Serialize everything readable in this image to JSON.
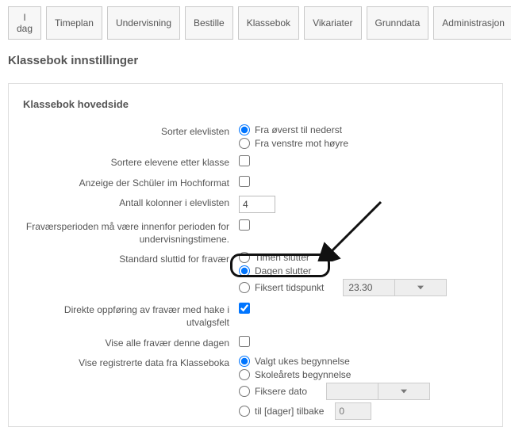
{
  "tabs": [
    "I dag",
    "Timeplan",
    "Undervisning",
    "Bestille",
    "Klassebok",
    "Vikariater",
    "Grunndata",
    "Administrasjon"
  ],
  "title": "Klassebok innstillinger",
  "section": "Klassebok hovedside",
  "labels": {
    "sort_list": "Sorter elevlisten",
    "sort_by_class": "Sortere elevene etter klasse",
    "hochformat": "Anzeige der Schüler im Hochformat",
    "columns": "Antall kolonner i elevlisten",
    "absence_period": "Fraværsperioden må være innenfor perioden for undervisningstimene.",
    "default_end": "Standard sluttid for fravær",
    "direct_entry": "Direkte oppføring av fravær med hake i utvalgsfelt",
    "show_all": "Vise alle fravær denne dagen",
    "show_registered": "Vise registrerte data fra Klasseboka"
  },
  "options": {
    "sort_a": "Fra øverst til nederst",
    "sort_b": "Fra venstre mot høyre",
    "end_a": "Timen slutter",
    "end_b": "Dagen slutter",
    "end_c": "Fiksert tidspunkt",
    "reg_a": "Valgt ukes begynnelse",
    "reg_b": "Skoleårets begynnelse",
    "reg_c": "Fiksere dato",
    "reg_d": "til [dager] tilbake"
  },
  "values": {
    "columns": "4",
    "fixed_time": "23.30",
    "days_back": "0"
  }
}
